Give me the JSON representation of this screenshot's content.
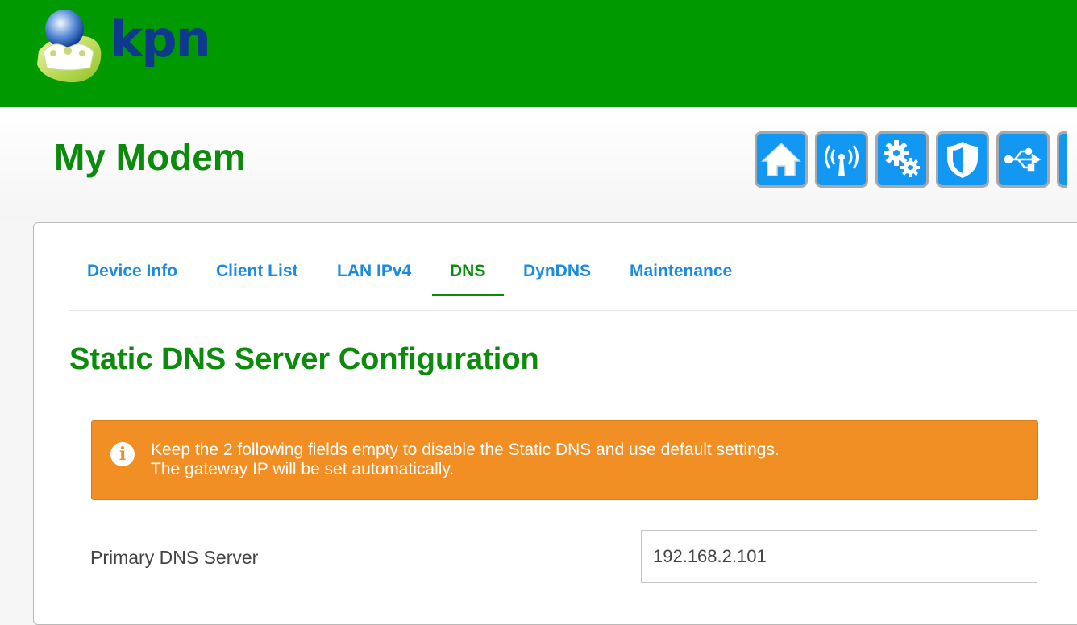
{
  "brand": {
    "name": "kpn",
    "header_color": "#009a00",
    "accent_green": "#0b8a0b",
    "link_blue": "#1a8be0"
  },
  "page": {
    "title": "My Modem"
  },
  "nav_icons": [
    "home-icon",
    "wifi-signal-icon",
    "gears-icon",
    "shield-icon",
    "usb-icon"
  ],
  "tabs": [
    {
      "label": "Device Info",
      "active": false
    },
    {
      "label": "Client List",
      "active": false
    },
    {
      "label": "LAN IPv4",
      "active": false
    },
    {
      "label": "DNS",
      "active": true
    },
    {
      "label": "DynDNS",
      "active": false
    },
    {
      "label": "Maintenance",
      "active": false
    }
  ],
  "section": {
    "title": "Static DNS Server Configuration"
  },
  "alert": {
    "color": "#f18f25",
    "icon": "info-icon",
    "line1": "Keep the 2 following fields empty to disable the Static DNS and use default settings.",
    "line2": "The gateway IP will be set automatically."
  },
  "form": {
    "primary_dns": {
      "label": "Primary DNS Server",
      "value": "192.168.2.101"
    }
  }
}
